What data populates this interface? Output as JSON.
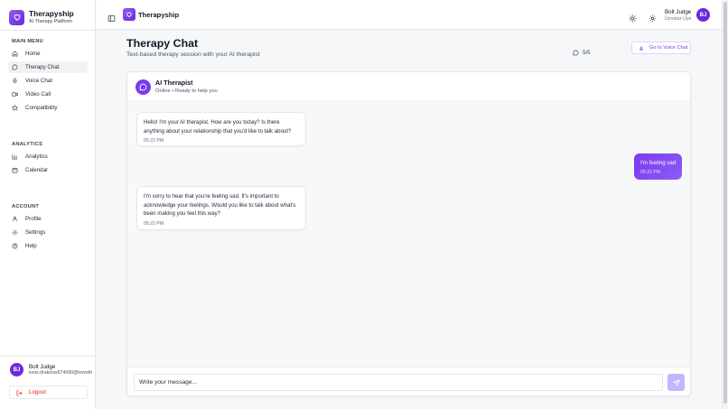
{
  "app": {
    "name": "Therapyship",
    "tagline": "AI Therapy Platform"
  },
  "sidebar": {
    "sections": [
      {
        "label": "MAIN MENU",
        "items": [
          {
            "label": "Home",
            "icon": "home-icon"
          },
          {
            "label": "Therapy Chat",
            "icon": "chat-bubble-icon",
            "active": true
          },
          {
            "label": "Voice Chat",
            "icon": "microphone-icon"
          },
          {
            "label": "Video Call",
            "icon": "video-camera-icon"
          },
          {
            "label": "Compatibility",
            "icon": "star-icon"
          }
        ]
      },
      {
        "label": "ANALYTICS",
        "items": [
          {
            "label": "Analytics",
            "icon": "bar-chart-icon"
          },
          {
            "label": "Calendar",
            "icon": "calendar-icon"
          }
        ]
      },
      {
        "label": "ACCOUNT",
        "items": [
          {
            "label": "Profile",
            "icon": "user-icon"
          },
          {
            "label": "Settings",
            "icon": "gear-icon"
          },
          {
            "label": "Help",
            "icon": "help-circle-icon"
          }
        ]
      }
    ],
    "user": {
      "initials": "BJ",
      "name": "Bolt Judge",
      "email": "ionix.drakonis674090@torveth"
    },
    "logout_label": "Logout"
  },
  "topbar": {
    "title": "Therapyship",
    "user_name": "Bolt Judge",
    "user_role": "Ücretsiz Üye",
    "user_initials": "BJ"
  },
  "page": {
    "title": "Therapy Chat",
    "subtitle": "Text-based therapy session with your AI therapist",
    "quota": "5/5",
    "voice_button_label": "Go to Voice Chat"
  },
  "chat": {
    "assistant_name": "AI Therapist",
    "assistant_status": "Online • Ready to help you",
    "messages": [
      {
        "role": "ai",
        "lines": [
          "Hello! I'm your AI therapist. How are you today? Is there",
          "anything about your relationship that you'd like to talk about?"
        ],
        "time": "05:22 PM"
      },
      {
        "role": "user",
        "lines": [
          "I'm feeling sad"
        ],
        "time": "05:22 PM"
      },
      {
        "role": "ai",
        "lines": [
          "I'm sorry to hear that you're feeling sad. It's important to",
          "acknowledge your feelings. Would you like to talk about what's",
          "been making you feel this way?"
        ],
        "time": "05:22 PM"
      }
    ],
    "input_placeholder": "Write your message...",
    "input_value": ""
  },
  "colors": {
    "accent": "#7c3aed",
    "logout": "#dc2626"
  }
}
